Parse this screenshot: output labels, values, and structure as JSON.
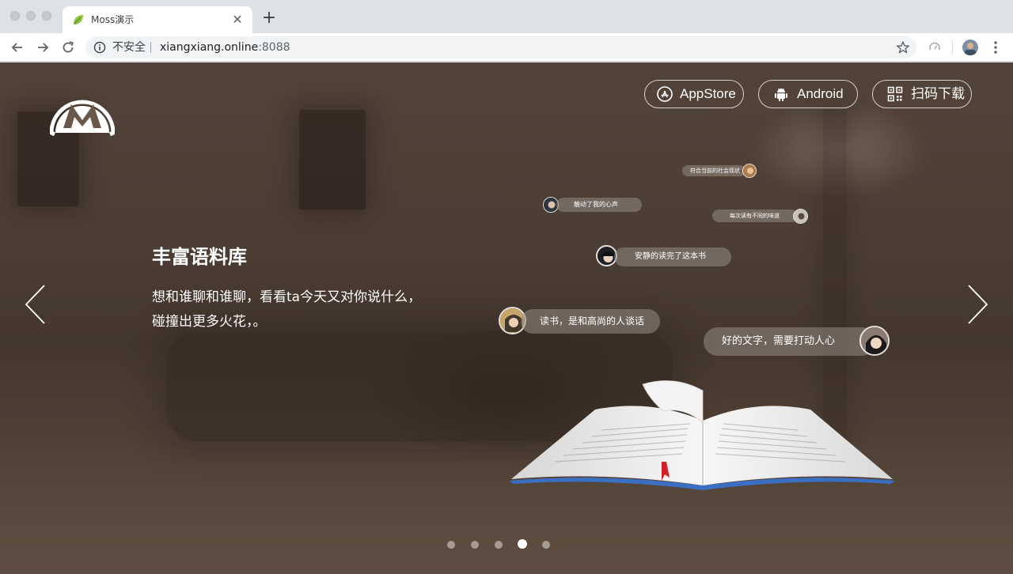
{
  "browser": {
    "tab_title": "Moss演示",
    "tab_close": "✕",
    "new_tab": "+",
    "security_label": "不安全",
    "url_host": "xiangxiang.online",
    "url_port": ":8088"
  },
  "page": {
    "downloads": [
      {
        "label": "AppStore",
        "icon": "appstore-icon"
      },
      {
        "label": "Android",
        "icon": "android-icon"
      },
      {
        "label": "扫码下载",
        "icon": "qrcode-icon"
      }
    ],
    "headline": "丰富语料库",
    "desc_line1": "想和谁聊和谁聊，看看ta今天又对你说什么，",
    "desc_line2": "碰撞出更多火花，。",
    "bubbles": [
      {
        "text": "符合当前的社会现状"
      },
      {
        "text": "触动了我的心声"
      },
      {
        "text": "每次读有不同的味道"
      },
      {
        "text": "安静的读完了这本书"
      },
      {
        "text": "读书，是和高尚的人谈话"
      },
      {
        "text": "好的文字，需要打动人心"
      }
    ],
    "carousel": {
      "total": 5,
      "active": 4
    }
  },
  "colors": {
    "accent_red": "#d0202a",
    "book_edge_blue": "#3b6fc4"
  }
}
